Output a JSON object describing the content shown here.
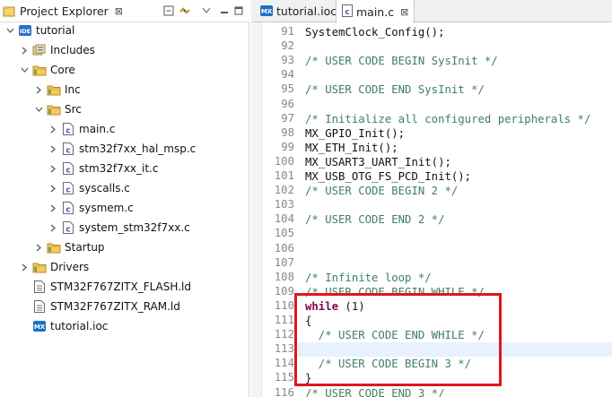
{
  "explorer": {
    "title": "Project Explorer",
    "close_glyph": "⊠",
    "tree": [
      {
        "label": "tutorial",
        "icon": "ide-project-icon",
        "expanded": true,
        "depth": 0
      },
      {
        "label": "Includes",
        "icon": "includes-icon",
        "expanded": false,
        "depth": 1
      },
      {
        "label": "Core",
        "icon": "folder-icon",
        "expanded": true,
        "depth": 1
      },
      {
        "label": "Inc",
        "icon": "folder-icon",
        "expanded": false,
        "depth": 2
      },
      {
        "label": "Src",
        "icon": "folder-icon",
        "expanded": true,
        "depth": 2
      },
      {
        "label": "main.c",
        "icon": "c-file-icon",
        "expanded": false,
        "depth": 3
      },
      {
        "label": "stm32f7xx_hal_msp.c",
        "icon": "c-file-icon",
        "expanded": false,
        "depth": 3
      },
      {
        "label": "stm32f7xx_it.c",
        "icon": "c-file-icon",
        "expanded": false,
        "depth": 3
      },
      {
        "label": "syscalls.c",
        "icon": "c-file-icon",
        "expanded": false,
        "depth": 3
      },
      {
        "label": "sysmem.c",
        "icon": "c-file-icon",
        "expanded": false,
        "depth": 3
      },
      {
        "label": "system_stm32f7xx.c",
        "icon": "c-file-icon",
        "expanded": false,
        "depth": 3
      },
      {
        "label": "Startup",
        "icon": "folder-icon",
        "expanded": false,
        "depth": 2
      },
      {
        "label": "Drivers",
        "icon": "folder-icon",
        "expanded": false,
        "depth": 1
      },
      {
        "label": "STM32F767ZITX_FLASH.ld",
        "icon": "ld-file-icon",
        "expanded": null,
        "depth": 1
      },
      {
        "label": "STM32F767ZITX_RAM.ld",
        "icon": "ld-file-icon",
        "expanded": null,
        "depth": 1
      },
      {
        "label": "tutorial.ioc",
        "icon": "mx-file-icon",
        "expanded": null,
        "depth": 1
      }
    ]
  },
  "editor": {
    "tabs": [
      {
        "label": "tutorial.ioc",
        "icon": "mx-file-icon",
        "active": false
      },
      {
        "label": "main.c",
        "icon": "c-file-icon",
        "active": true
      }
    ],
    "lines": [
      {
        "no": "91",
        "text": "SystemClock_Config();",
        "kind": "code"
      },
      {
        "no": "92",
        "text": "",
        "kind": "code"
      },
      {
        "no": "93",
        "text": "/* USER CODE BEGIN SysInit */",
        "kind": "comment"
      },
      {
        "no": "94",
        "text": "",
        "kind": "code"
      },
      {
        "no": "95",
        "text": "/* USER CODE END SysInit */",
        "kind": "comment"
      },
      {
        "no": "96",
        "text": "",
        "kind": "code"
      },
      {
        "no": "97",
        "text": "/* Initialize all configured peripherals */",
        "kind": "comment"
      },
      {
        "no": "98",
        "text": "MX_GPIO_Init();",
        "kind": "code"
      },
      {
        "no": "99",
        "text": "MX_ETH_Init();",
        "kind": "code"
      },
      {
        "no": "100",
        "text": "MX_USART3_UART_Init();",
        "kind": "code"
      },
      {
        "no": "101",
        "text": "MX_USB_OTG_FS_PCD_Init();",
        "kind": "code"
      },
      {
        "no": "102",
        "text": "/* USER CODE BEGIN 2 */",
        "kind": "comment"
      },
      {
        "no": "103",
        "text": "",
        "kind": "code"
      },
      {
        "no": "104",
        "text": "/* USER CODE END 2 */",
        "kind": "comment"
      },
      {
        "no": "105",
        "text": "",
        "kind": "code"
      },
      {
        "no": "106",
        "text": "",
        "kind": "code"
      },
      {
        "no": "107",
        "text": "",
        "kind": "code"
      },
      {
        "no": "108",
        "text": "/* Infinite loop */",
        "kind": "comment"
      },
      {
        "no": "109",
        "text": "/* USER CODE BEGIN WHILE */",
        "kind": "comment"
      },
      {
        "no": "110",
        "text": "while (1)",
        "kind": "while"
      },
      {
        "no": "111",
        "text": "{",
        "kind": "code"
      },
      {
        "no": "112",
        "text": "  /* USER CODE END WHILE */",
        "kind": "comment"
      },
      {
        "no": "113",
        "text": "",
        "kind": "code"
      },
      {
        "no": "114",
        "text": "  /* USER CODE BEGIN 3 */",
        "kind": "comment"
      },
      {
        "no": "115",
        "text": "}",
        "kind": "code"
      },
      {
        "no": "116",
        "text": "/* USER CODE END 3 */",
        "kind": "comment"
      }
    ],
    "current_line": "113",
    "colors": {
      "comment": "#3f7f5f",
      "keyword": "#7f0055",
      "highlight_box": "#e0151f",
      "current_line": "#e8f2fe"
    }
  }
}
